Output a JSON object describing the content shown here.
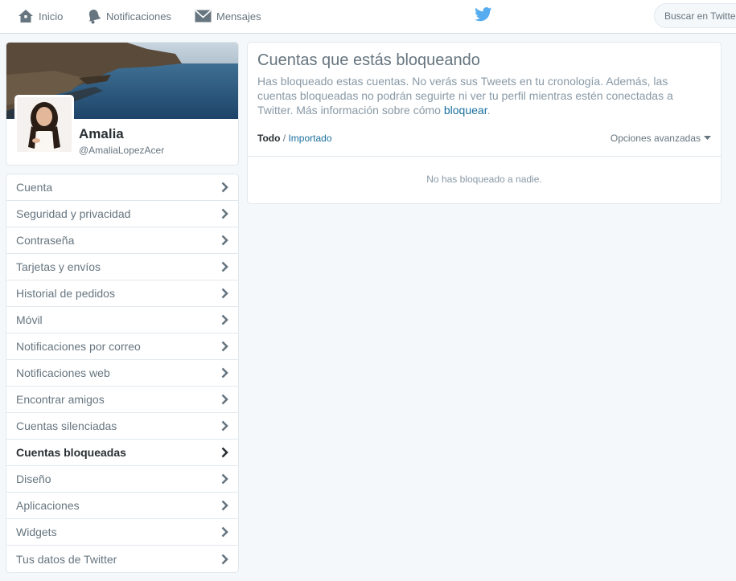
{
  "topbar": {
    "home_label": "Inicio",
    "notifications_label": "Notificaciones",
    "messages_label": "Mensajes",
    "search_placeholder": "Buscar en Twitter"
  },
  "profile": {
    "name": "Amalia",
    "handle": "@AmaliaLopezAcer"
  },
  "menu": {
    "items": [
      {
        "label": "Cuenta"
      },
      {
        "label": "Seguridad y privacidad"
      },
      {
        "label": "Contraseña"
      },
      {
        "label": "Tarjetas y envíos"
      },
      {
        "label": "Historial de pedidos"
      },
      {
        "label": "Móvil"
      },
      {
        "label": "Notificaciones por correo"
      },
      {
        "label": "Notificaciones web"
      },
      {
        "label": "Encontrar amigos"
      },
      {
        "label": "Cuentas silenciadas"
      },
      {
        "label": "Cuentas bloqueadas"
      },
      {
        "label": "Diseño"
      },
      {
        "label": "Aplicaciones"
      },
      {
        "label": "Widgets"
      },
      {
        "label": "Tus datos de Twitter"
      }
    ],
    "active_index": 10
  },
  "main": {
    "title": "Cuentas que estás bloqueando",
    "description": "Has bloqueado estas cuentas. No verás sus Tweets en tu cronología. Además, las cuentas bloqueadas no podrán seguirte ni ver tu perfil mientras estén conectadas a Twitter. Más información sobre cómo ",
    "description_link": "bloquear",
    "description_end": ".",
    "filter_all": "Todo",
    "filter_separator": "/",
    "filter_imported": "Importado",
    "advanced_options": "Opciones avanzadas",
    "empty_message": "No has bloqueado a nadie."
  },
  "colors": {
    "accent": "#55acee",
    "link": "#1b6fa0",
    "text_muted": "#66757f",
    "border": "#e1e8ed",
    "background": "#f5f8fa"
  },
  "icons": {
    "home": "home-icon",
    "notifications": "bell-icon",
    "messages": "envelope-icon",
    "logo": "twitter-bird-icon",
    "menu_chevron": "chevron-right-icon",
    "advanced_caret": "caret-down-icon"
  }
}
